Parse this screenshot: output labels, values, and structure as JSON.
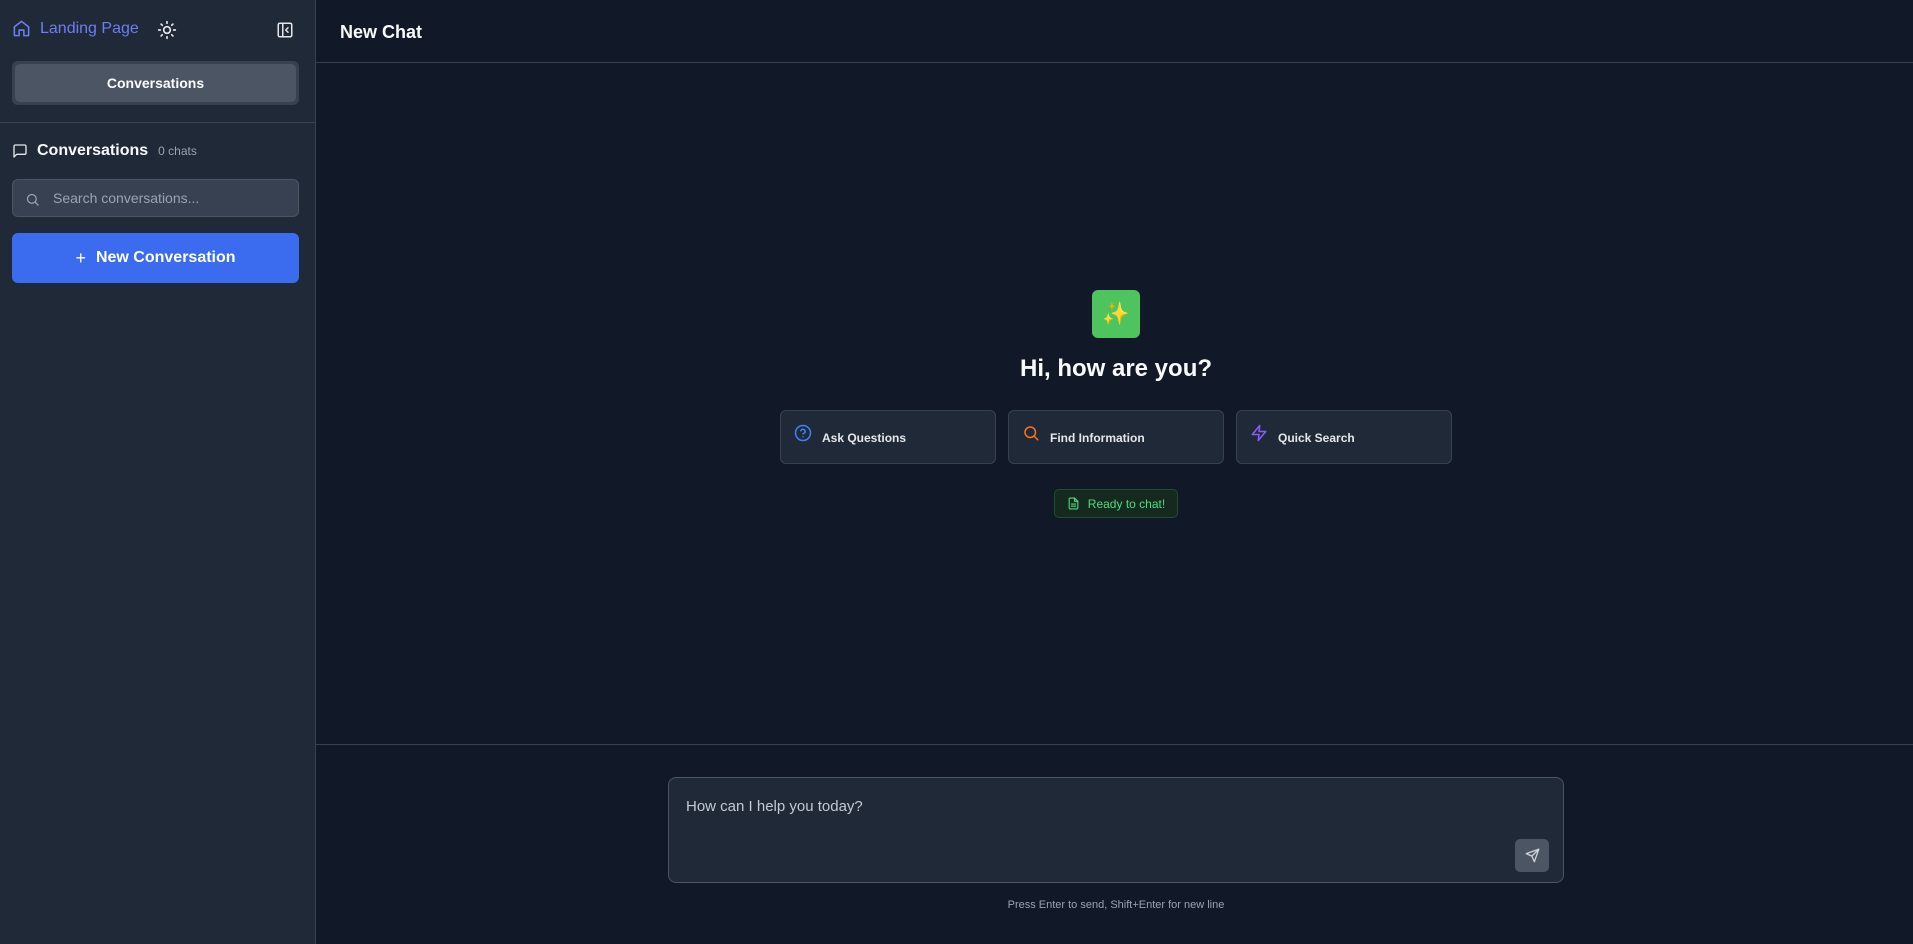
{
  "sidebar": {
    "home_label": "Landing Page",
    "tabs": [
      {
        "label": "Conversations",
        "active": true
      }
    ],
    "conversations": {
      "title": "Conversations",
      "count": "0 chats",
      "search_placeholder": "Search conversations...",
      "new_button_label": "New Conversation"
    }
  },
  "header": {
    "title": "New Chat"
  },
  "welcome": {
    "logo_glyph": "✨",
    "greeting": "Hi, how are you?",
    "cards": [
      {
        "label": "Ask Questions",
        "icon": "help-circle-icon",
        "color": "#3b82f6"
      },
      {
        "label": "Find Information",
        "icon": "search-icon",
        "color": "#f97316"
      },
      {
        "label": "Quick Search",
        "icon": "lightning-icon",
        "color": "#8b5cf6"
      }
    ],
    "status": "Ready to chat!"
  },
  "composer": {
    "placeholder": "How can I help you today?",
    "hint": "Press Enter to send, Shift+Enter for new line"
  },
  "colors": {
    "accent": "#3b6cf0",
    "link": "#6d7df4",
    "success": "#4ade80",
    "logo_bg": "#4ec35e"
  }
}
